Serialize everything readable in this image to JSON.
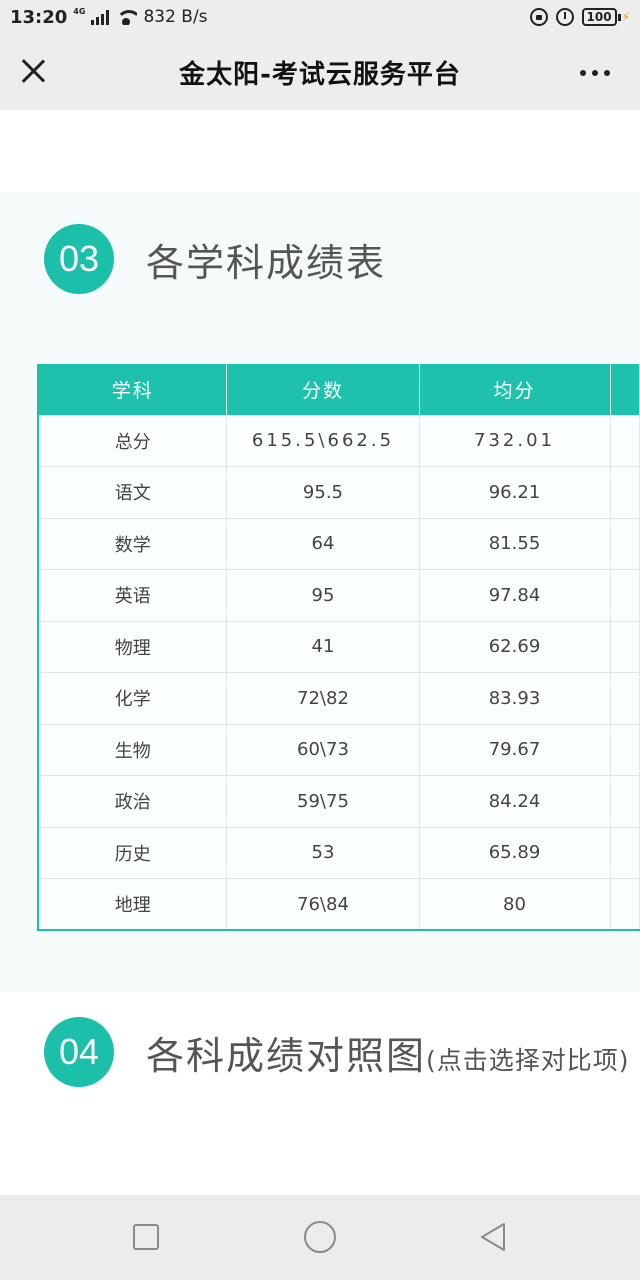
{
  "status": {
    "time": "13:20",
    "network": "4G",
    "speed": "832 B/s",
    "battery": "100"
  },
  "nav": {
    "title": "金太阳-考试云服务平台"
  },
  "section3": {
    "number": "03",
    "title": "各学科成绩表",
    "headers": [
      "学科",
      "分数",
      "均分"
    ],
    "rows": [
      {
        "subject": "总分",
        "score": "615.5\\662.5",
        "avg": "732.01"
      },
      {
        "subject": "语文",
        "score": "95.5",
        "avg": "96.21"
      },
      {
        "subject": "数学",
        "score": "64",
        "avg": "81.55"
      },
      {
        "subject": "英语",
        "score": "95",
        "avg": "97.84"
      },
      {
        "subject": "物理",
        "score": "41",
        "avg": "62.69"
      },
      {
        "subject": "化学",
        "score": "72\\82",
        "avg": "83.93"
      },
      {
        "subject": "生物",
        "score": "60\\73",
        "avg": "79.67"
      },
      {
        "subject": "政治",
        "score": "59\\75",
        "avg": "84.24"
      },
      {
        "subject": "历史",
        "score": "53",
        "avg": "65.89"
      },
      {
        "subject": "地理",
        "score": "76\\84",
        "avg": "80"
      }
    ]
  },
  "section4": {
    "number": "04",
    "title": "各科成绩对照图",
    "note": "(点击选择对比项)"
  },
  "colors": {
    "accent": "#1bbfaa"
  }
}
